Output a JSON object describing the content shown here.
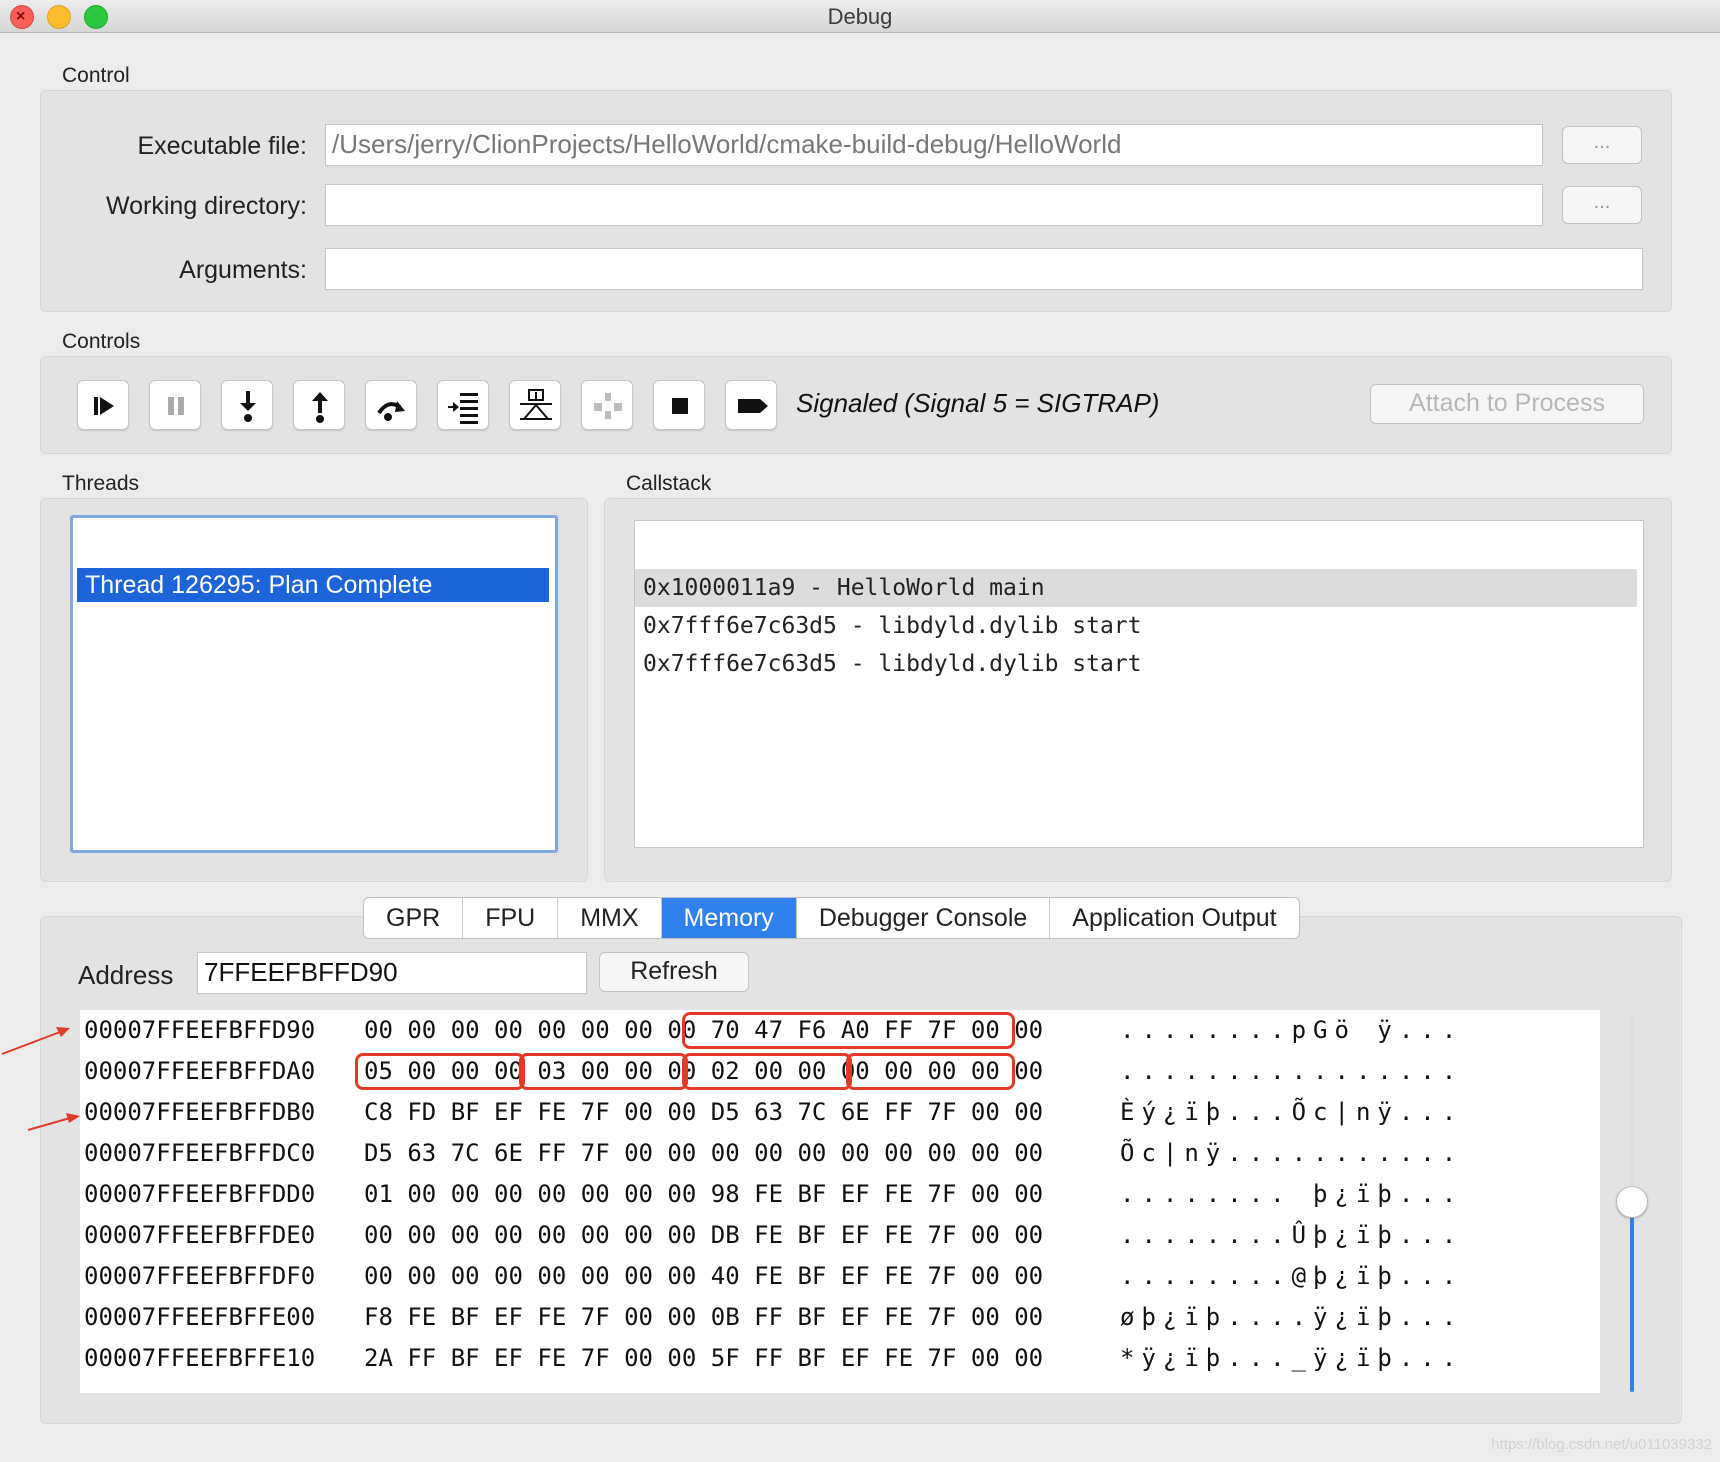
{
  "window": {
    "title": "Debug"
  },
  "control": {
    "label": "Control",
    "exe_label": "Executable file:",
    "exe_value": "/Users/jerry/ClionProjects/HelloWorld/cmake-build-debug/HelloWorld",
    "wd_label": "Working directory:",
    "wd_value": "",
    "args_label": "Arguments:",
    "args_value": "",
    "browse_label": "..."
  },
  "controls": {
    "label": "Controls",
    "buttons": [
      "continue-icon",
      "pause-icon",
      "step-into-icon",
      "step-out-icon",
      "step-over-icon",
      "step-instruction-icon",
      "step-over-instruction-icon",
      "step-disabled-icon",
      "stop-icon",
      "detach-icon"
    ],
    "status": "Signaled (Signal 5 = SIGTRAP)",
    "attach_label": "Attach to Process"
  },
  "threads": {
    "label": "Threads",
    "items": [
      "Thread 126295: Plan Complete"
    ]
  },
  "callstack": {
    "label": "Callstack",
    "items": [
      "0x1000011a9 - HelloWorld main",
      "0x7fff6e7c63d5 - libdyld.dylib start",
      "0x7fff6e7c63d5 - libdyld.dylib start"
    ]
  },
  "tabs": [
    "GPR",
    "FPU",
    "MMX",
    "Memory",
    "Debugger Console",
    "Application Output"
  ],
  "active_tab": "Memory",
  "memory": {
    "address_label": "Address",
    "address_value": "7FFEEFBFFD90",
    "refresh_label": "Refresh",
    "rows": [
      {
        "addr": "00007FFEEFBFFD90",
        "hex": "00 00 00 00 00 00 00 00 70 47 F6 A0 FF 7F 00 00",
        "ascii": "........pGö ÿ..."
      },
      {
        "addr": "00007FFEEFBFFDA0",
        "hex": "05 00 00 00 03 00 00 00 02 00 00 00 00 00 00 00",
        "ascii": "................"
      },
      {
        "addr": "00007FFEEFBFFDB0",
        "hex": "C8 FD BF EF FE 7F 00 00 D5 63 7C 6E FF 7F 00 00",
        "ascii": "Èý¿ïþ...Õc|nÿ..."
      },
      {
        "addr": "00007FFEEFBFFDC0",
        "hex": "D5 63 7C 6E FF 7F 00 00 00 00 00 00 00 00 00 00",
        "ascii": "Õc|nÿ..........."
      },
      {
        "addr": "00007FFEEFBFFDD0",
        "hex": "01 00 00 00 00 00 00 00 98 FE BF EF FE 7F 00 00",
        "ascii": "........ þ¿ïþ..."
      },
      {
        "addr": "00007FFEEFBFFDE0",
        "hex": "00 00 00 00 00 00 00 00 DB FE BF EF FE 7F 00 00",
        "ascii": "........Ûþ¿ïþ..."
      },
      {
        "addr": "00007FFEEFBFFDF0",
        "hex": "00 00 00 00 00 00 00 00 40 FE BF EF FE 7F 00 00",
        "ascii": "........@þ¿ïþ..."
      },
      {
        "addr": "00007FFEEFBFFE00",
        "hex": "F8 FE BF EF FE 7F 00 00 0B FF BF EF FE 7F 00 00",
        "ascii": "øþ¿ïþ....ÿ¿ïþ..."
      },
      {
        "addr": "00007FFEEFBFFE10",
        "hex": "2A FF BF EF FE 7F 00 00 5F FF BF EF FE 7F 00 00",
        "ascii": "*ÿ¿ïþ..._ÿ¿ïþ..."
      }
    ]
  },
  "annotation_color": "#e33a27",
  "accent_color": "#1d64d8",
  "watermark": "https://blog.csdn.net/u011039332"
}
